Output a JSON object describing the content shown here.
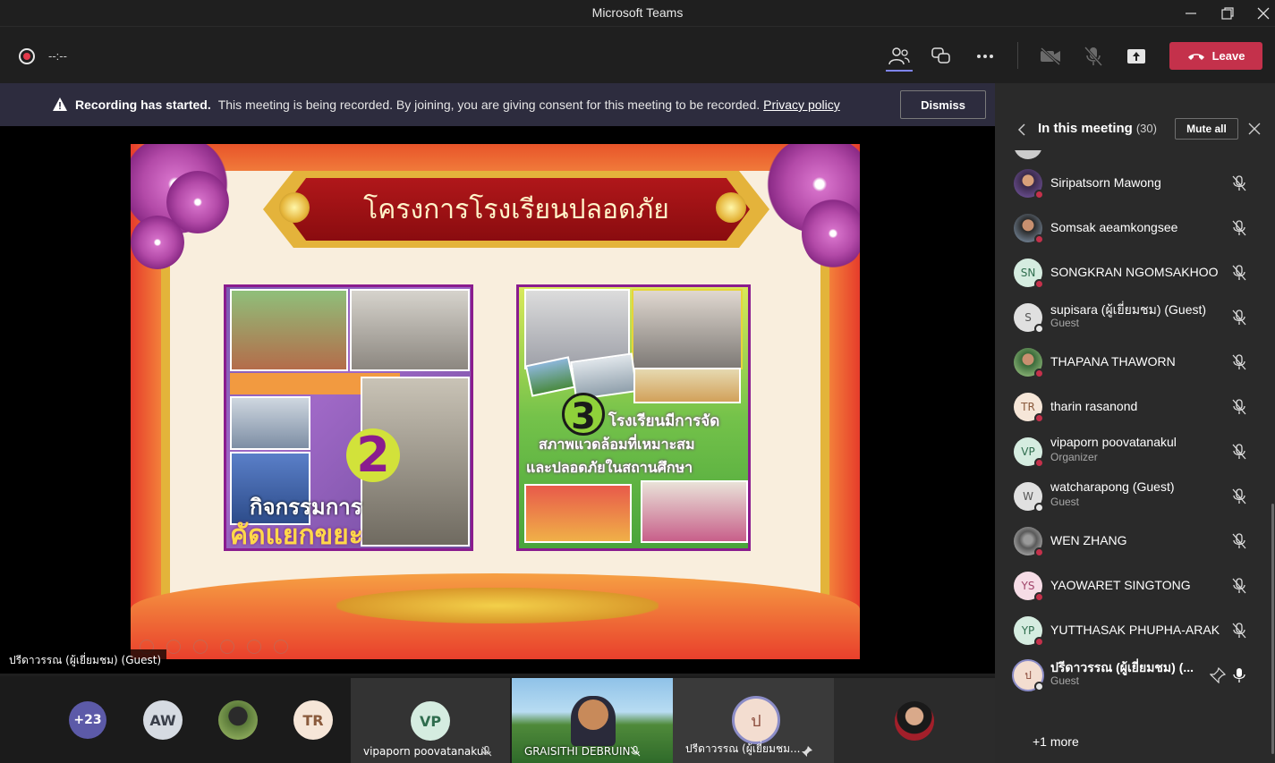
{
  "window": {
    "title": "Microsoft Teams"
  },
  "toolbar": {
    "timer": "--:--",
    "leave_label": "Leave"
  },
  "banner": {
    "title": "Recording has started.",
    "text": "This meeting is being recorded. By joining, you are giving consent for this meeting to be recorded.",
    "link": "Privacy policy",
    "dismiss_label": "Dismiss"
  },
  "slide": {
    "title": "โครงการโรงเรียนปลอดภัย",
    "left_number": "2",
    "left_caption_1": "กิจกรรมการ",
    "left_caption_2": "คัดแยกขยะ",
    "right_number": "3",
    "right_caption_1": "โรงเรียนมีการจัด",
    "right_caption_2": "สภาพแวดล้อมที่เหมาะสม",
    "right_caption_3": "และปลอดภัยในสถานศึกษา"
  },
  "presenter_label": "ปรีดาวรรณ (ผู้เยี่ยมชม) (Guest)",
  "strip": {
    "overflow": "+23",
    "tiles": [
      {
        "initials": "AW",
        "name": ""
      },
      {
        "initials": "TR",
        "name": ""
      },
      {
        "initials": "VP",
        "name": "vipaporn poovatanakul"
      },
      {
        "initials": "",
        "name": "GRAISITHI DEBRUIN"
      },
      {
        "initials": "ป",
        "name": "ปรีดาวรรณ (ผู้เยี่ยมชม..."
      }
    ]
  },
  "side": {
    "title": "In this meeting",
    "count": "(30)",
    "mute_all_label": "Mute all",
    "more_label": "+1 more",
    "participants": [
      {
        "name": "Siripatsorn Mawong",
        "role": "",
        "initials": ""
      },
      {
        "name": "Somsak aeamkongsee",
        "role": "",
        "initials": ""
      },
      {
        "name": "SONGKRAN NGOMSAKHOO",
        "role": "",
        "initials": "SN"
      },
      {
        "name": "supisara (ผู้เยี่ยมชม) (Guest)",
        "role": "Guest",
        "initials": "S"
      },
      {
        "name": "THAPANA THAWORN",
        "role": "",
        "initials": ""
      },
      {
        "name": "tharin rasanond",
        "role": "",
        "initials": "TR"
      },
      {
        "name": "vipaporn poovatanakul",
        "role": "Organizer",
        "initials": "VP"
      },
      {
        "name": "watcharapong (Guest)",
        "role": "Guest",
        "initials": "W"
      },
      {
        "name": "WEN ZHANG",
        "role": "",
        "initials": ""
      },
      {
        "name": "YAOWARET SINGTONG",
        "role": "",
        "initials": "YS"
      },
      {
        "name": "YUTTHASAK PHUPHA-ARAK",
        "role": "",
        "initials": "YP"
      },
      {
        "name": "ปรีดาวรรณ (ผู้เยี่ยมชม) (...",
        "role": "Guest",
        "initials": "ป"
      }
    ]
  },
  "colors": {
    "accent": "#7f85f5",
    "leave": "#c4314b",
    "banner_bg": "#2d2c3e",
    "status_busy": "#c4314b",
    "status_away": "#e6e6e6"
  }
}
